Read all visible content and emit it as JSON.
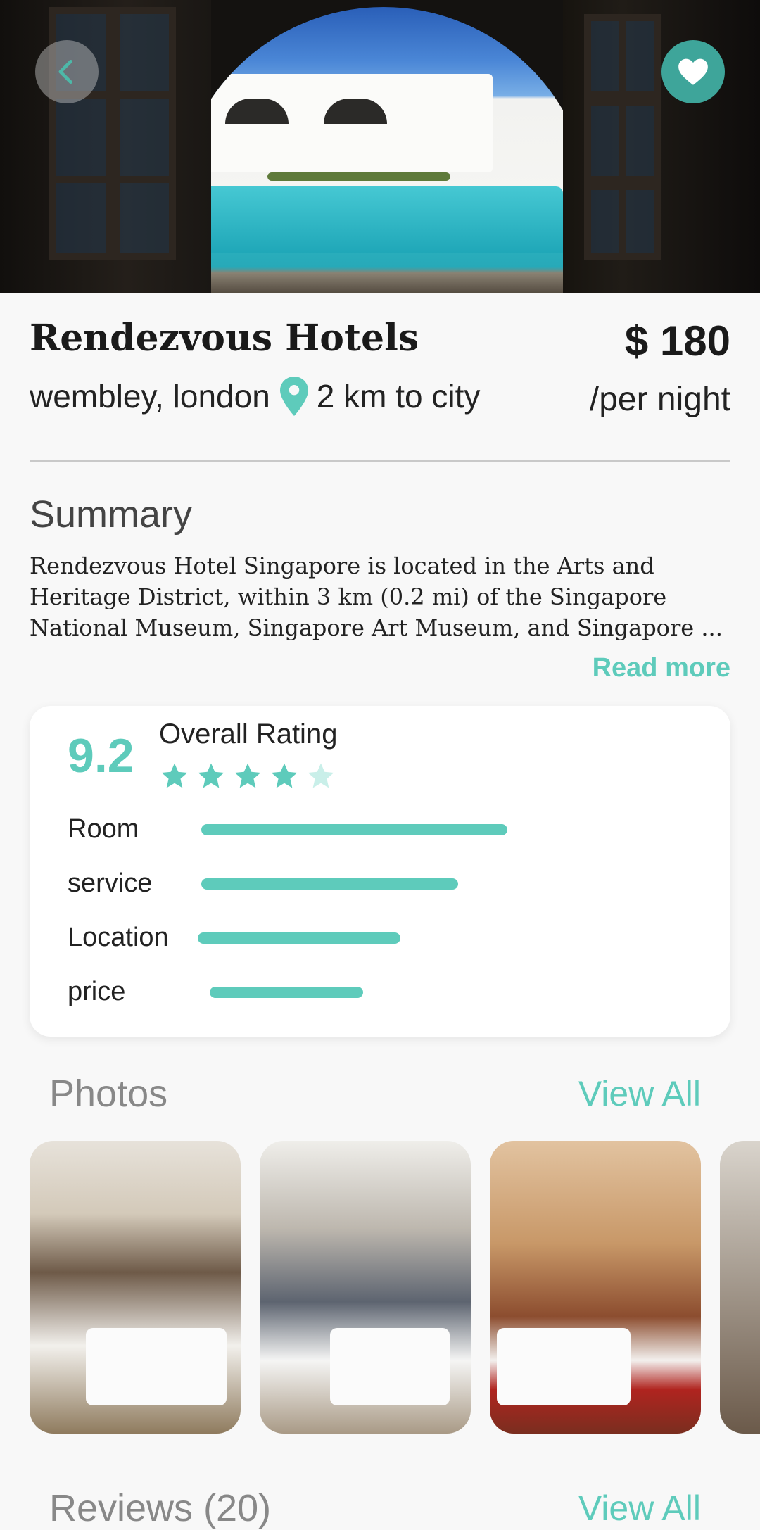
{
  "header": {
    "back_icon": "chevron-left-icon",
    "favorite_icon": "heart-icon"
  },
  "hotel": {
    "name": "Rendezvous Hotels",
    "location": "wembley, london",
    "distance": "2 km to city",
    "price": "$ 180",
    "price_unit": "/per night"
  },
  "summary": {
    "title": "Summary",
    "text": "Rendezvous Hotel Singapore is located in the Arts and Heritage District, within 3 km (0.2 mi) of the Singapore National Museum, Singapore Art Museum, and Singapore ...",
    "read_more": "Read more"
  },
  "rating": {
    "score": "9.2",
    "label": "Overall Rating",
    "stars": 4,
    "stars_max": 5,
    "categories": [
      {
        "label": "Room",
        "value": 0.68
      },
      {
        "label": "service",
        "value": 0.57
      },
      {
        "label": "Location",
        "value": 0.45
      },
      {
        "label": "price",
        "value": 0.34
      }
    ]
  },
  "photos": {
    "title": "Photos",
    "view_all": "View All",
    "items": [
      "hotel-room-photo-1",
      "hotel-room-photo-2",
      "hotel-room-photo-3",
      "hotel-room-photo-4"
    ]
  },
  "reviews": {
    "title": "Reviews (20)",
    "view_all": "View All"
  },
  "colors": {
    "accent": "#5ecbbb",
    "favorite_button": "#3ea59a",
    "star_empty": "#c9efe9"
  }
}
